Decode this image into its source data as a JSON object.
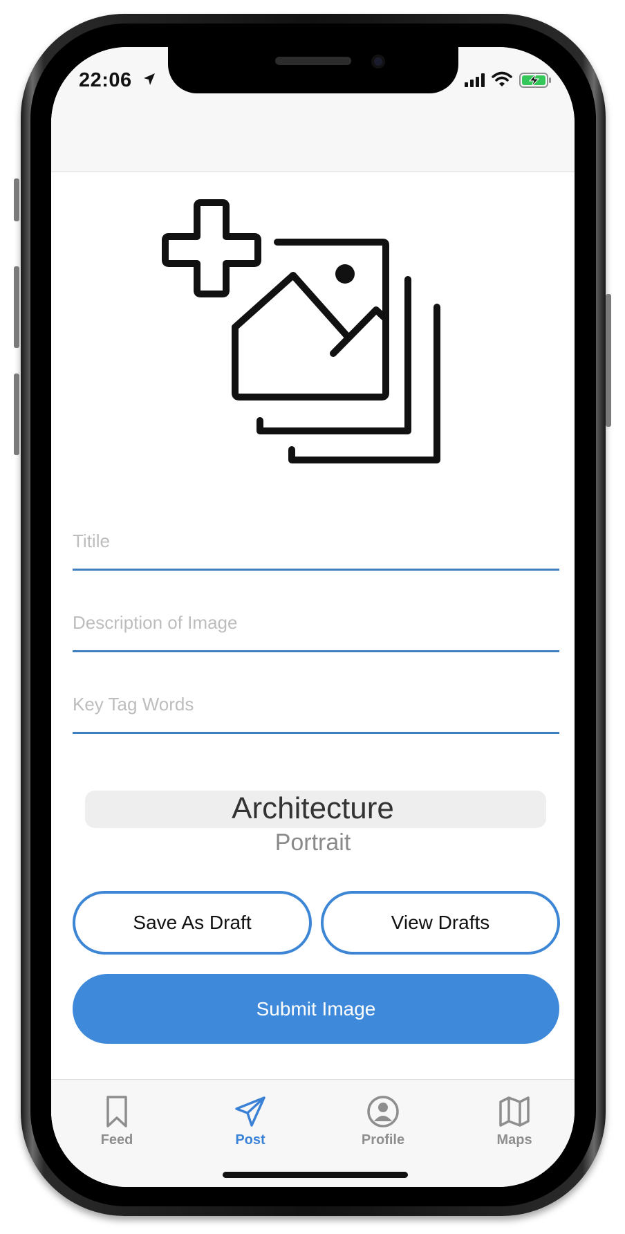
{
  "status_bar": {
    "time": "22:06"
  },
  "form": {
    "title_placeholder": "Titile",
    "description_placeholder": "Description of Image",
    "tags_placeholder": "Key Tag Words"
  },
  "picker": {
    "selected": "Architecture",
    "next": "Portrait"
  },
  "buttons": {
    "save_draft": "Save As Draft",
    "view_drafts": "View Drafts",
    "submit": "Submit Image"
  },
  "tabbar": {
    "tabs": [
      {
        "label": "Feed",
        "icon": "bookmark-icon",
        "active": false
      },
      {
        "label": "Post",
        "icon": "paper-plane-icon",
        "active": true
      },
      {
        "label": "Profile",
        "icon": "person-circle-icon",
        "active": false
      },
      {
        "label": "Maps",
        "icon": "map-icon",
        "active": false
      }
    ]
  },
  "colors": {
    "accent": "#3e89d9",
    "field_underline": "#3f7fbf",
    "battery_charge": "#34c759"
  }
}
